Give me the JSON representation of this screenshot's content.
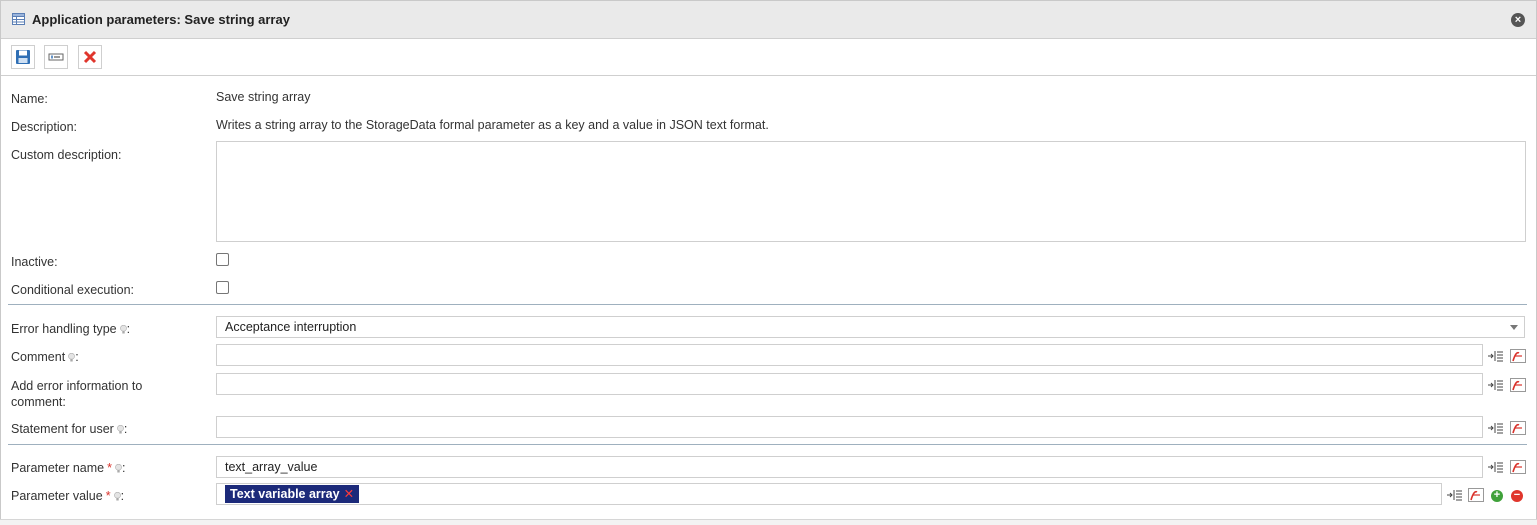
{
  "window": {
    "title": "Application parameters: Save string array"
  },
  "fields": {
    "name": {
      "label": "Name:",
      "value": "Save string array"
    },
    "description": {
      "label": "Description:",
      "value": "Writes a string array to the StorageData formal parameter as a key and a value in JSON text format."
    },
    "custom_description": {
      "label": "Custom description:",
      "value": ""
    },
    "inactive": {
      "label": "Inactive:",
      "checked": false
    },
    "conditional_execution": {
      "label": "Conditional execution:",
      "checked": false
    },
    "error_handling_type": {
      "label": "Error handling type",
      "value": "Acceptance interruption"
    },
    "comment": {
      "label": "Comment",
      "value": ""
    },
    "add_error_info": {
      "label_line1": "Add error information to",
      "label_line2": "comment:",
      "value": ""
    },
    "statement_for_user": {
      "label": "Statement for user",
      "value": ""
    },
    "parameter_name": {
      "label": "Parameter name",
      "required_mark": "*",
      "value": "text_array_value"
    },
    "parameter_value": {
      "label": "Parameter value",
      "required_mark": "*",
      "tag": "Text variable array"
    }
  },
  "colors": {
    "tag_bg": "#1c2a7a",
    "required": "#d9322b",
    "add_button": "#3fa13a",
    "remove_button": "#e0362c",
    "separator": "#9fb0be"
  },
  "icons": [
    "table-icon",
    "close-icon",
    "save-icon",
    "input-field-icon",
    "delete-icon",
    "hint-icon",
    "insert-variable-icon",
    "formula-icon",
    "add-icon",
    "remove-icon"
  ]
}
